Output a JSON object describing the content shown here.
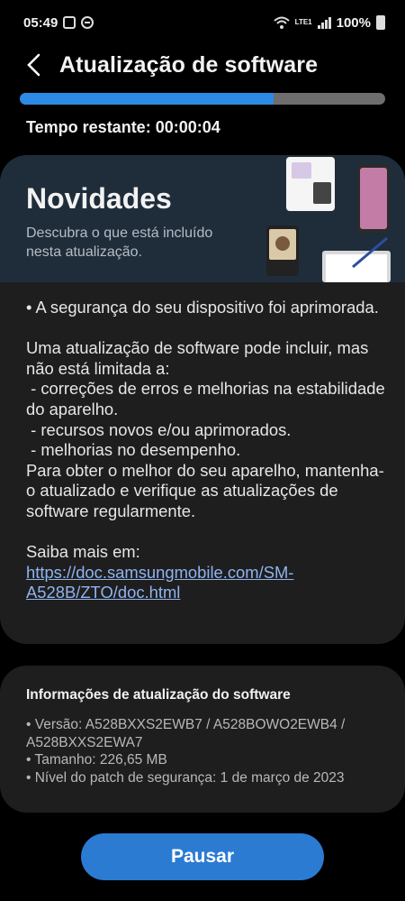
{
  "status_bar": {
    "time": "05:49",
    "network_label": "LTE1",
    "battery": "100%"
  },
  "header": {
    "title": "Atualização de software"
  },
  "progress": {
    "percent": 69.5
  },
  "remaining": {
    "label": "Tempo restante:",
    "value": "00:00:04"
  },
  "news": {
    "title": "Novidades",
    "subtitle": "Descubra o que está incluído nesta atualização."
  },
  "release_notes": {
    "text": "• A segurança do seu dispositivo foi aprimorada.\n\nUma atualização de software pode incluir, mas não está limitada a:\n - correções de erros e melhorias na estabilidade do aparelho.\n - recursos novos e/ou aprimorados.\n - melhorias no desempenho.\nPara obter o melhor do seu aparelho, mantenha-o atualizado e verifique as atualizações de software regularmente.\n\nSaiba mais em:",
    "link": "https://doc.samsungmobile.com/SM-A528B/ZTO/doc.html"
  },
  "info": {
    "title": "Informações de atualização do software",
    "items": [
      "• Versão: A528BXXS2EWB7 / A528BOWO2EWB4 / A528BXXS2EWA7",
      "• Tamanho: 226,65 MB",
      "• Nível do patch de segurança: 1 de março de 2023"
    ]
  },
  "actions": {
    "pause_label": "Pausar"
  },
  "colors": {
    "accent": "#2b7bd2",
    "progress": "#2d8ae4",
    "banner": "#1f2d3b",
    "link": "#8fb3f0"
  },
  "icons": [
    "back-arrow-icon",
    "screen-record-icon",
    "do-not-disturb-icon",
    "wifi-icon",
    "signal-icon",
    "battery-icon"
  ]
}
